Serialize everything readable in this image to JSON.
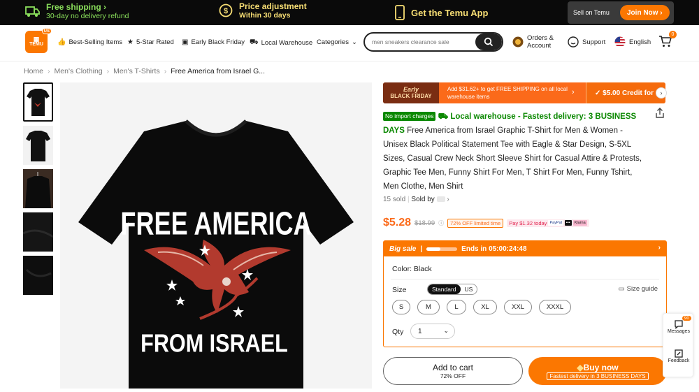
{
  "promo": {
    "shipping_title": "Free shipping",
    "shipping_sub": "30-day no delivery refund",
    "price_title": "Price adjustment",
    "price_sub": "Within 30 days",
    "app_label": "Get the Temu App",
    "sell_label": "Sell on Temu",
    "join_label": "Join Now"
  },
  "header": {
    "logo_text": "TEMU",
    "logo_badge": "US",
    "nav": [
      "Best-Selling Items",
      "5-Star Rated",
      "Early Black Friday",
      "Local Warehouse",
      "Categories"
    ],
    "search_placeholder": "men sneakers clearance sale",
    "orders_line1": "Orders &",
    "orders_line2": "Account",
    "support": "Support",
    "language": "English",
    "cart_count": "0"
  },
  "breadcrumb": [
    "Home",
    "Men's Clothing",
    "Men's T-Shirts",
    "Free America from Israel G..."
  ],
  "product_image": {
    "line1": "FREE AMERICA",
    "line2": "FROM ISRAEL"
  },
  "banner": {
    "tag_line1": "Early",
    "tag_line2": "BLACK FRIDAY",
    "text": "Add $31.62+ to get FREE SHIPPING on all local warehouse items",
    "credit": "✓ $5.00 Credit for"
  },
  "product": {
    "no_import": "No import charges",
    "warehouse": "Local warehouse - Fastest delivery: 3 BUSINESS DAYS",
    "title": "Free America from Israel Graphic T-Shirt for Men & Women - Unisex Black Political Statement Tee with Eagle & Star Design, S-5XL Sizes, Casual Crew Neck Short Sleeve Shirt for Casual Attire & Protests, Graphic Tee Men, Funny Shirt For Men, T Shirt For Men, Funny Tshirt, Men Clothe, Men Shirt",
    "sold": "15 sold",
    "sold_by": "Sold by",
    "price": "$5.28",
    "orig_price": "$18.99",
    "off_tag": "72% OFF limited time",
    "pay_tag": "Pay $1.32 today",
    "pay_methods": [
      "PayPal",
      "Klarna"
    ]
  },
  "sale": {
    "label": "Big sale",
    "ends": "Ends in 05:00:24:48",
    "progress": 0.45,
    "color_label": "Color: Black",
    "size_label": "Size",
    "size_systems": [
      "Standard",
      "US"
    ],
    "size_guide": "Size guide",
    "sizes": [
      "S",
      "M",
      "L",
      "XL",
      "XXL",
      "XXXL"
    ],
    "qty_label": "Qty",
    "qty_value": "1"
  },
  "actions": {
    "add_cart": "Add to cart",
    "add_cart_sub": "72% OFF",
    "buy_now": "Buy now",
    "buy_now_sub": "Fastest delivery in 3 BUSINESS DAYS"
  },
  "side": {
    "messages": "Messages",
    "messages_badge": "90",
    "feedback": "Feedback"
  },
  "colors": {
    "accent": "#fb7701",
    "green": "#0a8800",
    "promo_green": "#8be05c",
    "promo_yellow": "#f7de74"
  }
}
